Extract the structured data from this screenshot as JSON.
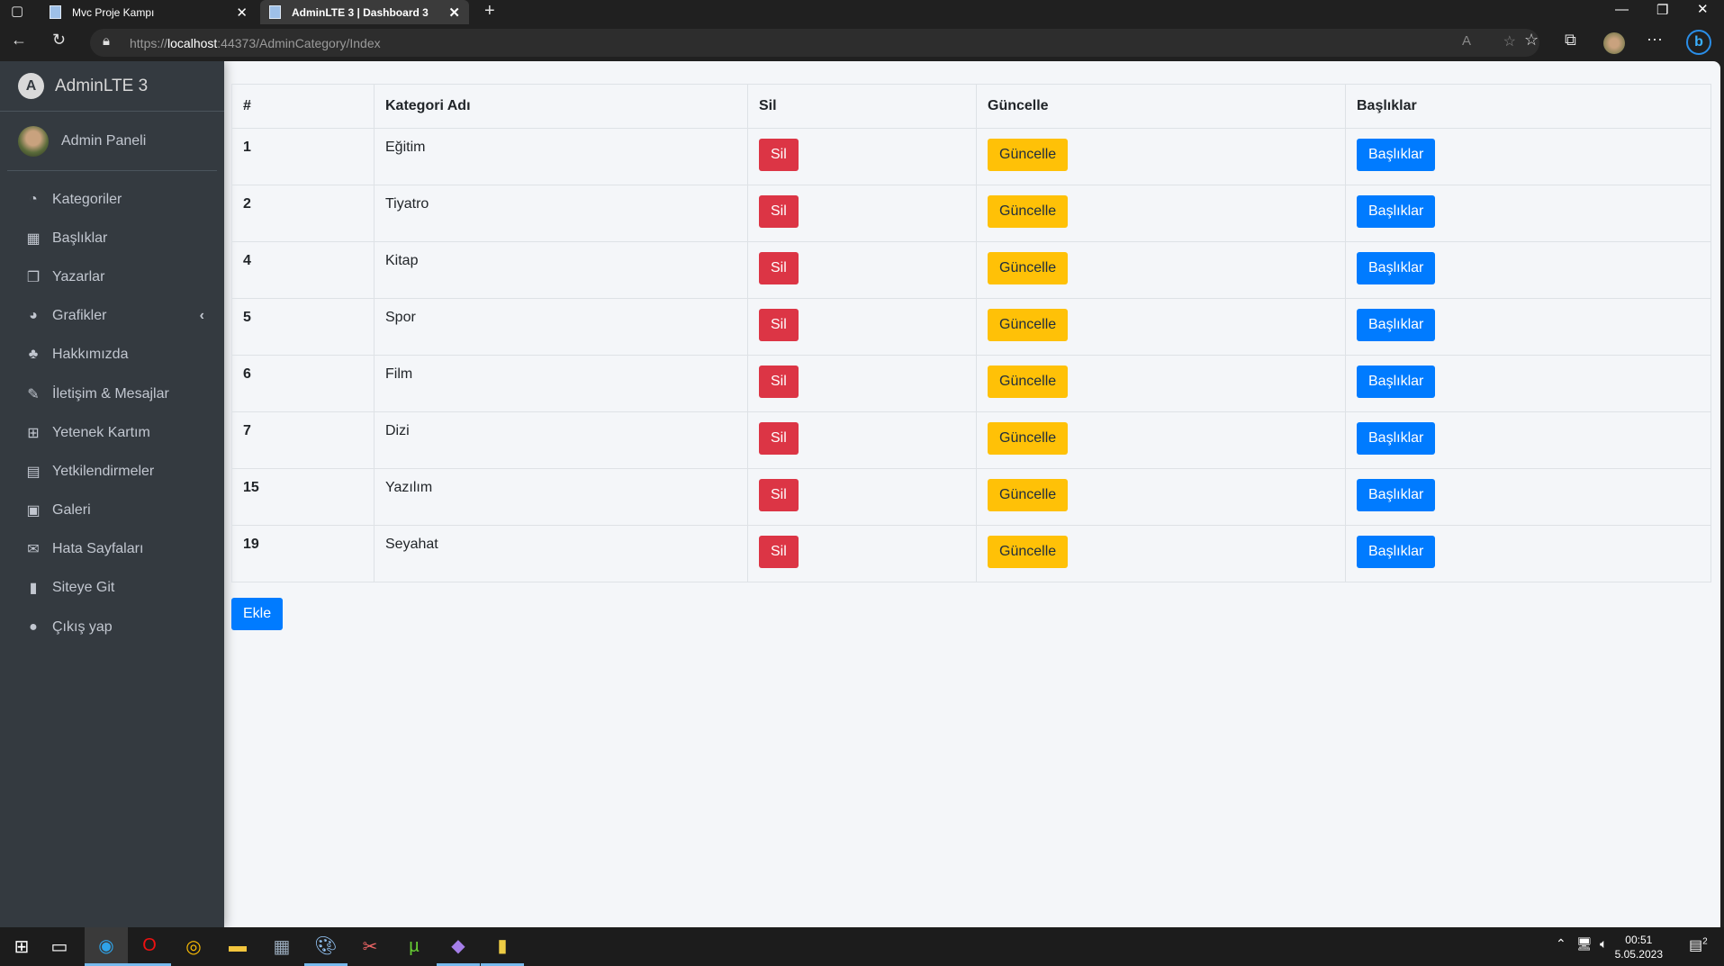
{
  "browser": {
    "tabs": [
      {
        "title": "Mvc Proje Kampı"
      },
      {
        "title": "AdminLTE 3 | Dashboard 3"
      }
    ],
    "url_prefix": "https://",
    "url_host": "localhost",
    "url_rest": ":44373/AdminCategory/Index"
  },
  "sidebar": {
    "brand": "AdminLTE 3",
    "user": "Admin Paneli",
    "items": [
      {
        "label": "Kategoriler",
        "icon": "tachometer-icon",
        "glyph": "◔"
      },
      {
        "label": "Başlıklar",
        "icon": "grid-icon",
        "glyph": "▦"
      },
      {
        "label": "Yazarlar",
        "icon": "copy-icon",
        "glyph": "❐"
      },
      {
        "label": "Grafikler",
        "icon": "pie-chart-icon",
        "glyph": "◕"
      },
      {
        "label": "Hakkımızda",
        "icon": "tree-icon",
        "glyph": "♣"
      },
      {
        "label": "İletişim & Mesajlar",
        "icon": "edit-icon",
        "glyph": "✎"
      },
      {
        "label": "Yetenek Kartım",
        "icon": "table-icon",
        "glyph": "⊞"
      },
      {
        "label": "Yetkilendirmeler",
        "icon": "calendar-icon",
        "glyph": "▤"
      },
      {
        "label": "Galeri",
        "icon": "image-icon",
        "glyph": "▣"
      },
      {
        "label": "Hata Sayfaları",
        "icon": "envelope-icon",
        "glyph": "✉"
      },
      {
        "label": "Siteye Git",
        "icon": "book-icon",
        "glyph": "▮"
      },
      {
        "label": "Çıkış yap",
        "icon": "apple-icon",
        "glyph": "●"
      }
    ]
  },
  "table": {
    "headers": [
      "#",
      "Kategori Adı",
      "Sil",
      "Güncelle",
      "Başlıklar"
    ],
    "rows": [
      {
        "id": "1",
        "name": "Eğitim"
      },
      {
        "id": "2",
        "name": "Tiyatro"
      },
      {
        "id": "4",
        "name": "Kitap"
      },
      {
        "id": "5",
        "name": "Spor"
      },
      {
        "id": "6",
        "name": "Film"
      },
      {
        "id": "7",
        "name": "Dizi"
      },
      {
        "id": "15",
        "name": "Yazılım"
      },
      {
        "id": "19",
        "name": "Seyahat"
      }
    ],
    "delete_label": "Sil",
    "update_label": "Güncelle",
    "titles_label": "Başlıklar"
  },
  "add_label": "Ekle",
  "taskbar": {
    "time": "00:51",
    "date": "5.05.2023",
    "notifications": "2"
  }
}
